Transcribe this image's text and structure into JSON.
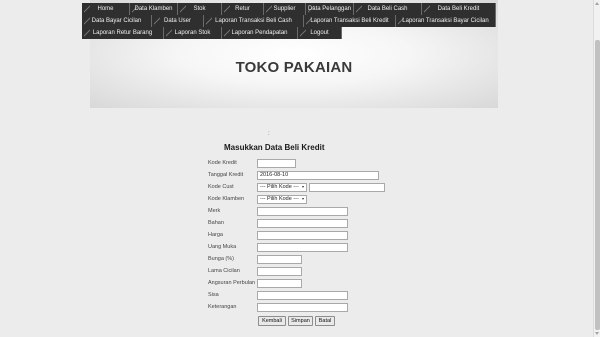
{
  "nav": {
    "row1": [
      "Home",
      "Data Klamben",
      "Stok",
      "Retur",
      "Supplier",
      "Data Pelanggan",
      "Data Beli Cash",
      "Data Beli Kredit"
    ],
    "row2": [
      "Data Bayar Cicilan",
      "Data User",
      "Laporan Transaksi Beli Cash",
      "Laporan Transaksi Beli Kredit",
      "Laporan Transaksi Bayar Cicilan"
    ],
    "row3": [
      "Laporan Retur Barang",
      "Laporan Stok",
      "Laporan Pendapatan",
      "Logout"
    ]
  },
  "banner": {
    "title": "TOKO PAKAIAN"
  },
  "separator": ":",
  "form": {
    "title": "Masukkan Data Beli Kredit",
    "labels": {
      "kode_kredit": "Kode Kredit",
      "tanggal_kredit": "Tanggal Kredit",
      "kode_cust": "Kode Cust",
      "kode_klamben": "Kode Klamben",
      "merk": "Merk",
      "bahan": "Bahan",
      "harga": "Harga",
      "uang_muka": "Uang Muka",
      "bunga": "Bunga (%)",
      "lama_cicilan": "Lama Cicilan",
      "angsuran_perbulan": "Angsuran Perbulan",
      "sisa": "Sisa",
      "keterangan": "Keterangan"
    },
    "values": {
      "kode_kredit": "",
      "tanggal_kredit": "2016-08-10",
      "kode_cust_select": "--- Pilih Kode ---",
      "kode_cust_name": "",
      "kode_klamben_select": "--- Pilih Kode ---",
      "merk": "",
      "bahan": "",
      "harga": "",
      "uang_muka": "",
      "bunga": "",
      "lama_cicilan": "",
      "angsuran_perbulan": "",
      "sisa": "",
      "keterangan": ""
    },
    "buttons": {
      "kembali": "Kembali",
      "simpan": "Simpan",
      "batal": "Batal"
    }
  }
}
